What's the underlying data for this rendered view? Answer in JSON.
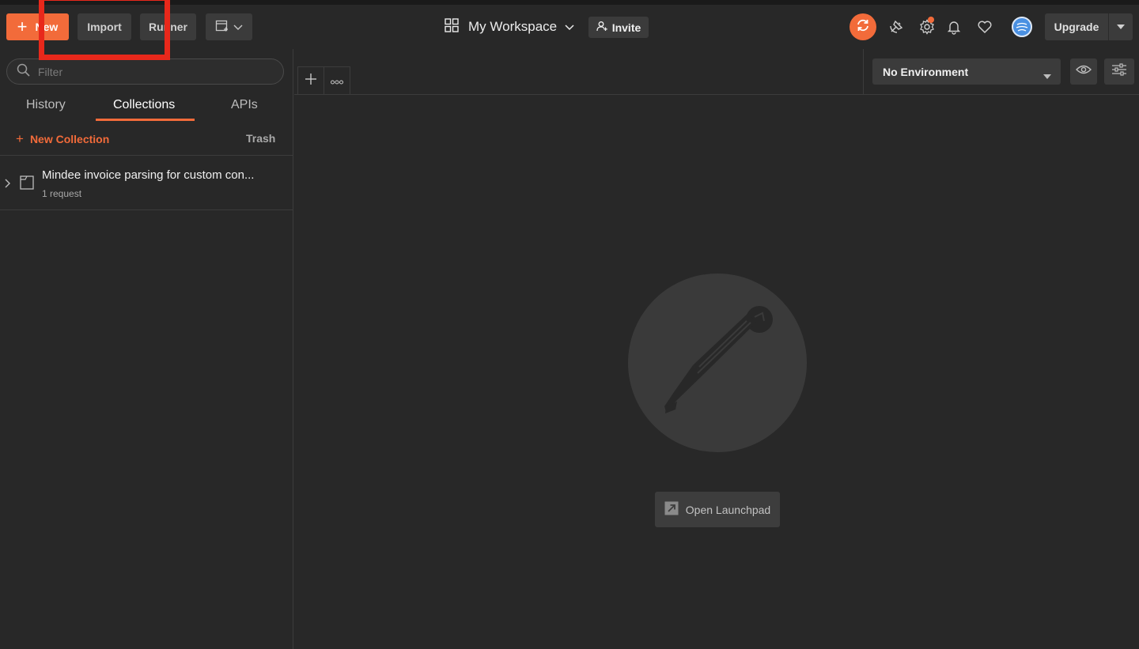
{
  "header": {
    "new_label": "New",
    "import_label": "Import",
    "runner_label": "Runner",
    "workspace_label": "My Workspace",
    "invite_label": "Invite",
    "upgrade_label": "Upgrade"
  },
  "sidebar": {
    "filter_placeholder": "Filter",
    "tabs": [
      {
        "label": "History"
      },
      {
        "label": "Collections"
      },
      {
        "label": "APIs"
      }
    ],
    "active_tab": "Collections",
    "new_collection_label": "New Collection",
    "trash_label": "Trash",
    "collections": [
      {
        "name": "Mindee invoice parsing for custom con...",
        "subtitle": "1 request"
      }
    ]
  },
  "environment": {
    "selected": "No Environment"
  },
  "main": {
    "open_launchpad_label": "Open Launchpad"
  },
  "icons": {
    "sync": "sync-icon",
    "satellite": "satellite-icon",
    "settings": "gear-icon",
    "notifications": "bell-icon",
    "favorites": "heart-icon",
    "eye": "eye-icon",
    "sliders": "sliders-icon"
  },
  "colors": {
    "accent": "#f26b3a",
    "background": "#282828",
    "button": "#3b3b3b",
    "highlight": "#e8281b"
  }
}
